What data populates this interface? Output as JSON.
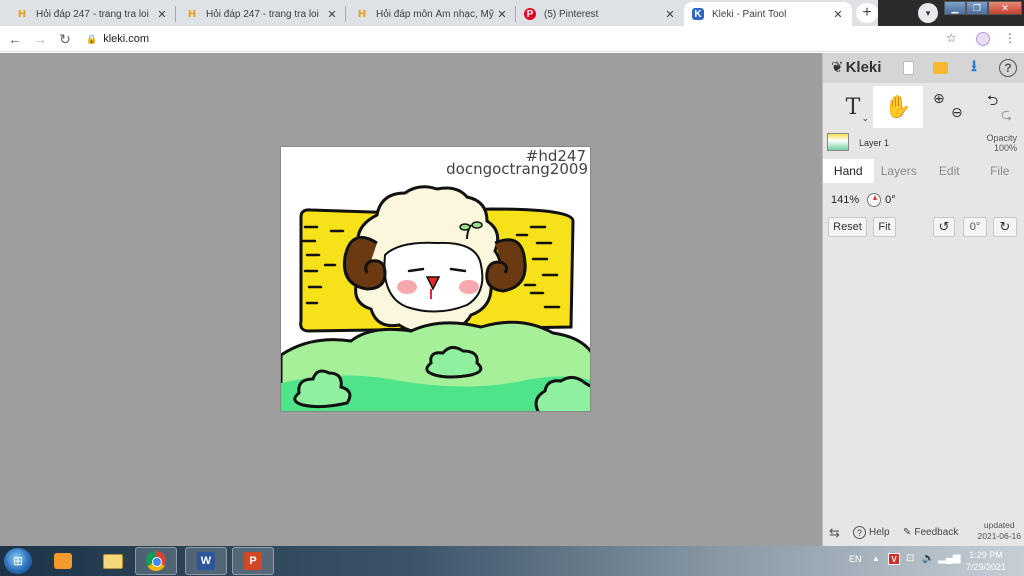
{
  "browser": {
    "tabs": [
      {
        "title": "Hỏi đáp 247 - trang tra loi",
        "favicon": "h-icon"
      },
      {
        "title": "Hỏi đáp 247 - trang tra loi",
        "favicon": "h-icon"
      },
      {
        "title": "Hỏi đáp môn Âm nhạc, Mỹ thu",
        "favicon": "h-icon"
      },
      {
        "title": "(5) Pinterest",
        "favicon": "pinterest-icon"
      },
      {
        "title": "Kleki - Paint Tool",
        "favicon": "kleki-icon",
        "active": true
      }
    ],
    "close_glyph": "✕",
    "new_tab_glyph": "+",
    "url": "kleki.com"
  },
  "canvas": {
    "watermark_tag": "#hd247",
    "watermark_author": "docngoctrang2009",
    "colors": {
      "stage": "#9e9e9e",
      "yellow": "#f7e21a",
      "green_light": "#a7f09a",
      "green_dark": "#4fe38a",
      "brown": "#6b3a12",
      "wool": "#fbf7dc"
    }
  },
  "panel": {
    "logo": "Kleki",
    "tools": {
      "text": "T",
      "hand": "✋",
      "zoom_in": "⊕",
      "zoom_out": "⊖",
      "undo": "⮌",
      "redo": "⮎"
    },
    "layer": {
      "name": "Layer 1",
      "opacity_label": "Opacity",
      "opacity_value": "100%"
    },
    "tabs": [
      "Hand",
      "Layers",
      "Edit",
      "File"
    ],
    "active_tab": "Hand",
    "hand": {
      "zoom": "141%",
      "angle": "0°",
      "reset_label": "Reset",
      "fit_label": "Fit",
      "angle_button": "0°"
    },
    "footer": {
      "help": "Help",
      "feedback": "Feedback",
      "updated_label": "updated",
      "updated_date": "2021-06-16"
    }
  },
  "taskbar": {
    "apps": [
      "media-player",
      "file-explorer",
      "chrome",
      "word",
      "powerpoint"
    ],
    "word_letter": "W",
    "ppt_letter": "P",
    "lang": "EN",
    "time": "1:29 PM",
    "date": "7/29/2021"
  }
}
